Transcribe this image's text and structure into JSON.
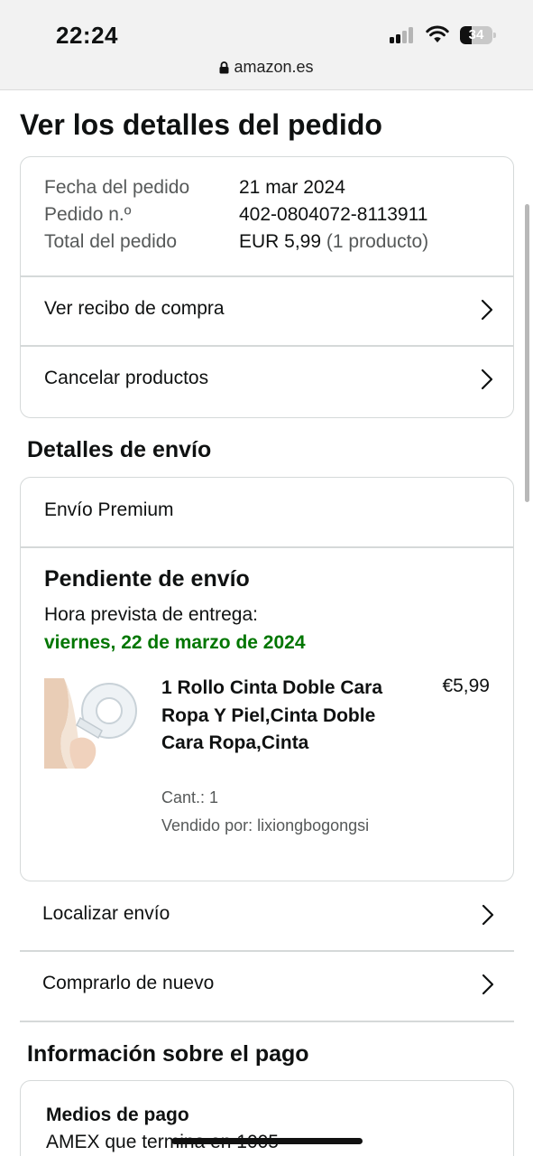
{
  "status_bar": {
    "time": "22:24",
    "battery_level": "34",
    "signal_icon": "cellular-signal-icon",
    "wifi_icon": "wifi-icon",
    "battery_icon": "battery-icon"
  },
  "browser": {
    "url": "amazon.es",
    "lock_icon": "lock-icon"
  },
  "page": {
    "title": "Ver los detalles del pedido"
  },
  "order_summary": {
    "date_label": "Fecha del pedido",
    "date_value": "21 mar 2024",
    "order_no_label": "Pedido n.º",
    "order_no_value": "402-0804072-8113911",
    "total_label": "Total del pedido",
    "total_value": "EUR 5,99",
    "total_count": "(1 producto)",
    "receipt_link": "Ver recibo de compra",
    "cancel_link": "Cancelar productos"
  },
  "shipping": {
    "section_title": "Detalles de envío",
    "type": "Envío Premium",
    "status": "Pendiente de envío",
    "eta_label": "Hora prevista de entrega:",
    "eta_date": "viernes, 22 de marzo de 2024",
    "product": {
      "name": "1 Rollo Cinta Doble Cara Ropa Y Piel,Cinta Doble Cara Ropa,Cinta",
      "price": "€5,99",
      "quantity": "Cant.: 1",
      "seller": "Vendido por: lixiongbogongsi"
    },
    "track_link": "Localizar envío",
    "buy_again_link": "Comprarlo de nuevo"
  },
  "payment": {
    "section_title": "Información sobre el pago",
    "methods_title": "Medios de pago",
    "method_line": "AMEX  que termina en 1005"
  },
  "colors": {
    "accent_green": "#007600",
    "border": "#d5d9d9",
    "muted_text": "#565959"
  }
}
